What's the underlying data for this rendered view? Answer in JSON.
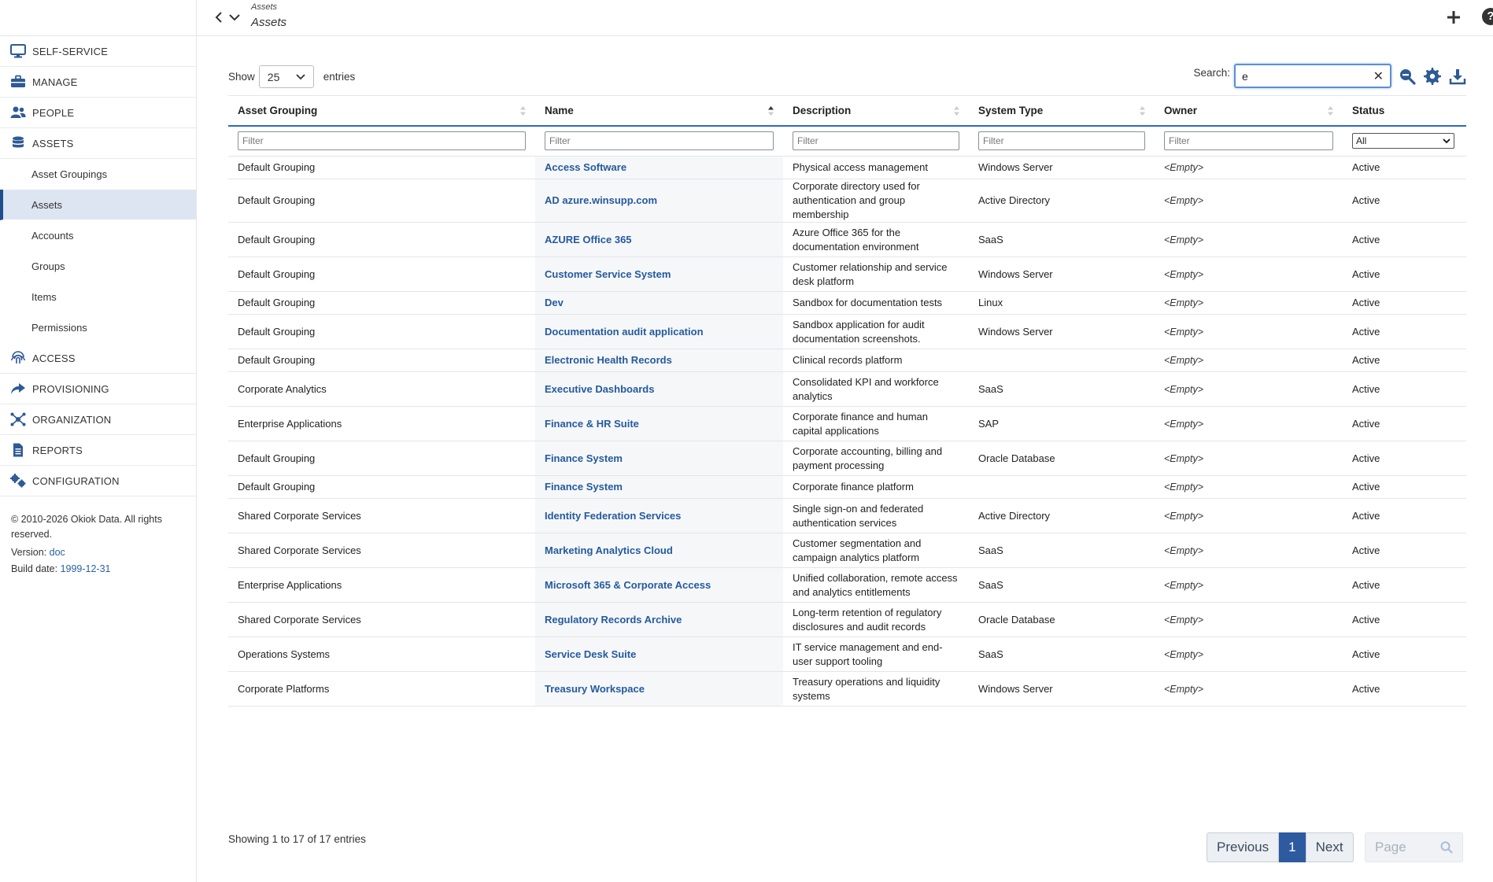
{
  "topbar": {
    "crumb_small": "Assets",
    "crumb_title": "Assets",
    "help_label": "?"
  },
  "sidebar": {
    "items": [
      {
        "label": "SELF-SERVICE",
        "icon": "monitor-icon"
      },
      {
        "label": "MANAGE",
        "icon": "briefcase-icon"
      },
      {
        "label": "PEOPLE",
        "icon": "people-icon"
      },
      {
        "label": "ASSETS",
        "icon": "database-icon"
      }
    ],
    "sub_items": [
      "Asset Groupings",
      "Assets",
      "Accounts",
      "Groups",
      "Items",
      "Permissions"
    ],
    "items_after": [
      {
        "label": "ACCESS",
        "icon": "fingerprint-icon"
      },
      {
        "label": "PROVISIONING",
        "icon": "share-icon"
      },
      {
        "label": "ORGANIZATION",
        "icon": "network-icon"
      },
      {
        "label": "REPORTS",
        "icon": "report-icon"
      },
      {
        "label": "CONFIGURATION",
        "icon": "cogs-icon"
      }
    ],
    "footer": {
      "copyright": "© 2010-2026 Okiok Data. All rights reserved.",
      "version_label": "Version:",
      "version_value": "doc",
      "build_label": "Build date:",
      "build_value": "1999-12-31"
    }
  },
  "controls": {
    "show_label": "Show",
    "page_size": "25",
    "entries_label": "entries",
    "search_label": "Search:",
    "search_value": "e",
    "clear_label": "✕"
  },
  "table": {
    "columns": [
      "Asset Grouping",
      "Name",
      "Description",
      "System Type",
      "Owner",
      "Status"
    ],
    "filter_placeholder": "Filter",
    "status_filter_value": "All",
    "rows": [
      {
        "grouping": "Default Grouping",
        "name": "Access Software",
        "description": "Physical access management",
        "system_type": "Windows Server",
        "owner": "<Empty>",
        "status": "Active"
      },
      {
        "grouping": "Default Grouping",
        "name": "AD azure.winsupp.com",
        "description": "Corporate directory used for authentication and group membership",
        "system_type": "Active Directory",
        "owner": "<Empty>",
        "status": "Active"
      },
      {
        "grouping": "Default Grouping",
        "name": "AZURE Office 365",
        "description": "Azure Office 365 for the documentation environment",
        "system_type": "SaaS",
        "owner": "<Empty>",
        "status": "Active"
      },
      {
        "grouping": "Default Grouping",
        "name": "Customer Service System",
        "description": "Customer relationship and service desk platform",
        "system_type": "Windows Server",
        "owner": "<Empty>",
        "status": "Active"
      },
      {
        "grouping": "Default Grouping",
        "name": "Dev",
        "description": "Sandbox for documentation tests",
        "system_type": "Linux",
        "owner": "<Empty>",
        "status": "Active"
      },
      {
        "grouping": "Default Grouping",
        "name": "Documentation audit application",
        "description": "Sandbox application for audit documentation screenshots.",
        "system_type": "Windows Server",
        "owner": "<Empty>",
        "status": "Active"
      },
      {
        "grouping": "Default Grouping",
        "name": "Electronic Health Records",
        "description": "Clinical records platform",
        "system_type": "",
        "owner": "<Empty>",
        "status": "Active"
      },
      {
        "grouping": "Corporate Analytics",
        "name": "Executive Dashboards",
        "description": "Consolidated KPI and workforce analytics",
        "system_type": "SaaS",
        "owner": "<Empty>",
        "status": "Active"
      },
      {
        "grouping": "Enterprise Applications",
        "name": "Finance & HR Suite",
        "description": "Corporate finance and human capital applications",
        "system_type": "SAP",
        "owner": "<Empty>",
        "status": "Active"
      },
      {
        "grouping": "Default Grouping",
        "name": "Finance System",
        "description": "Corporate accounting, billing and payment processing",
        "system_type": "Oracle Database",
        "owner": "<Empty>",
        "status": "Active"
      },
      {
        "grouping": "Default Grouping",
        "name": "Finance System",
        "description": "Corporate finance platform",
        "system_type": "",
        "owner": "<Empty>",
        "status": "Active"
      },
      {
        "grouping": "Shared Corporate Services",
        "name": "Identity Federation Services",
        "description": "Single sign-on and federated authentication services",
        "system_type": "Active Directory",
        "owner": "<Empty>",
        "status": "Active"
      },
      {
        "grouping": "Shared Corporate Services",
        "name": "Marketing Analytics Cloud",
        "description": "Customer segmentation and campaign analytics platform",
        "system_type": "SaaS",
        "owner": "<Empty>",
        "status": "Active"
      },
      {
        "grouping": "Enterprise Applications",
        "name": "Microsoft 365 & Corporate Access",
        "description": "Unified collaboration, remote access and analytics entitlements",
        "system_type": "SaaS",
        "owner": "<Empty>",
        "status": "Active"
      },
      {
        "grouping": "Shared Corporate Services",
        "name": "Regulatory Records Archive",
        "description": "Long-term retention of regulatory disclosures and audit records",
        "system_type": "Oracle Database",
        "owner": "<Empty>",
        "status": "Active"
      },
      {
        "grouping": "Operations Systems",
        "name": "Service Desk Suite",
        "description": "IT service management and end-user support tooling",
        "system_type": "SaaS",
        "owner": "<Empty>",
        "status": "Active"
      },
      {
        "grouping": "Corporate Platforms",
        "name": "Treasury Workspace",
        "description": "Treasury operations and liquidity systems",
        "system_type": "Windows Server",
        "owner": "<Empty>",
        "status": "Active"
      }
    ]
  },
  "footer": {
    "info": "Showing 1 to 17 of 17 entries",
    "previous": "Previous",
    "current_page": "1",
    "next": "Next",
    "page_placeholder": "Page"
  }
}
